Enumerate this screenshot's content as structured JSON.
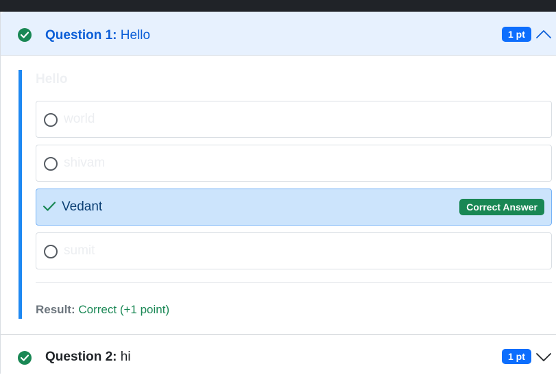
{
  "questions": [
    {
      "label": "Question 1:",
      "text": "Hello",
      "points": "1 pt",
      "prompt": "Hello",
      "options": [
        {
          "text": "world",
          "state": "unselected"
        },
        {
          "text": "shivam",
          "state": "unselected"
        },
        {
          "text": "Vedant",
          "state": "correct",
          "badge": "Correct Answer"
        },
        {
          "text": "sumit",
          "state": "unselected"
        }
      ],
      "result_label": "Result:",
      "result_value": "Correct (+1 point)",
      "expanded": true
    },
    {
      "label": "Question 2:",
      "text": "hi",
      "points": "1 pt",
      "expanded": false
    }
  ],
  "colors": {
    "accent": "#0d6efd",
    "success": "#198754",
    "header_open_bg": "#e7f1fe",
    "correct_option_bg": "#cce4fc",
    "left_bar": "#1e88f2"
  },
  "icons": {
    "status": "check-circle-icon",
    "expanded": "chevron-up-icon",
    "collapsed": "chevron-down-icon",
    "selected_option": "checkmark-icon",
    "unselected_option": "radio-circle-icon"
  }
}
